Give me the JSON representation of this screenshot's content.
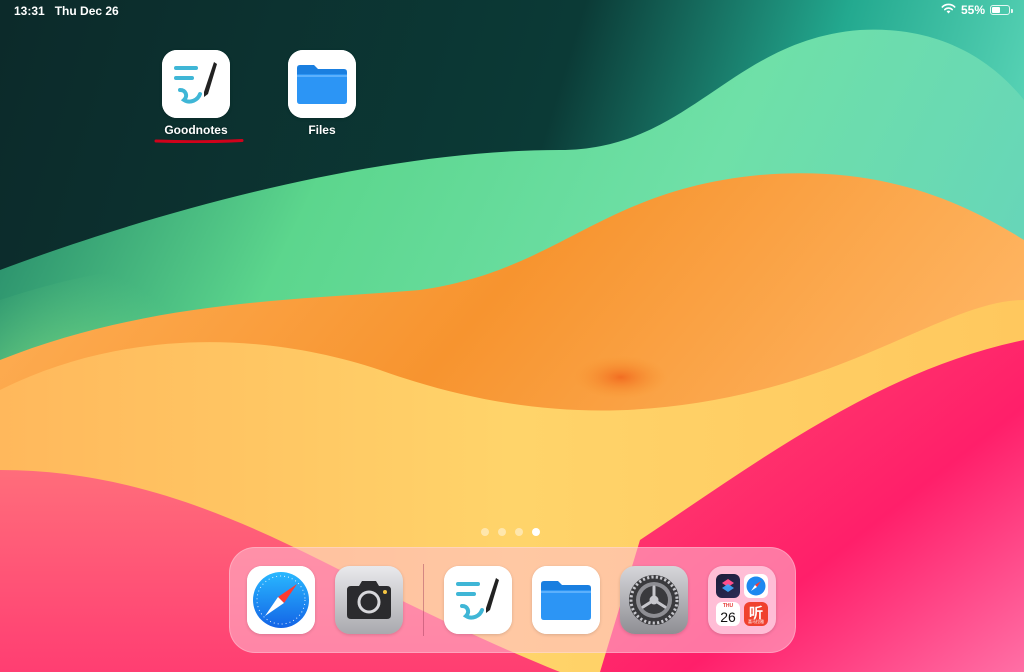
{
  "status_bar": {
    "time": "13:31",
    "date": "Thu Dec 26",
    "wifi_icon": "wifi-icon",
    "battery_percent_text": "55%",
    "battery_level": 0.55
  },
  "home_apps": [
    {
      "label": "Goodnotes",
      "icon": "goodnotes-icon"
    },
    {
      "label": "Files",
      "icon": "files-icon"
    }
  ],
  "page_indicator": {
    "count": 4,
    "current": 4
  },
  "dock": {
    "apps": [
      {
        "name": "Safari",
        "icon": "safari-icon"
      },
      {
        "name": "Camera",
        "icon": "camera-icon"
      },
      {
        "name": "Goodnotes",
        "icon": "goodnotes-icon"
      },
      {
        "name": "Files",
        "icon": "files-icon"
      },
      {
        "name": "Settings",
        "icon": "settings-icon"
      }
    ],
    "folder": {
      "icon": "app-folder-icon",
      "calendar_weekday": "THU",
      "calendar_day": "26",
      "ting_glyph": "听",
      "ting_subtitle": "喜马拉雅"
    }
  },
  "colors": {
    "annotation_underline": "#d0021b",
    "goodnotes_accent": "#3fb6d6",
    "files_blue": "#1e8cf2"
  }
}
